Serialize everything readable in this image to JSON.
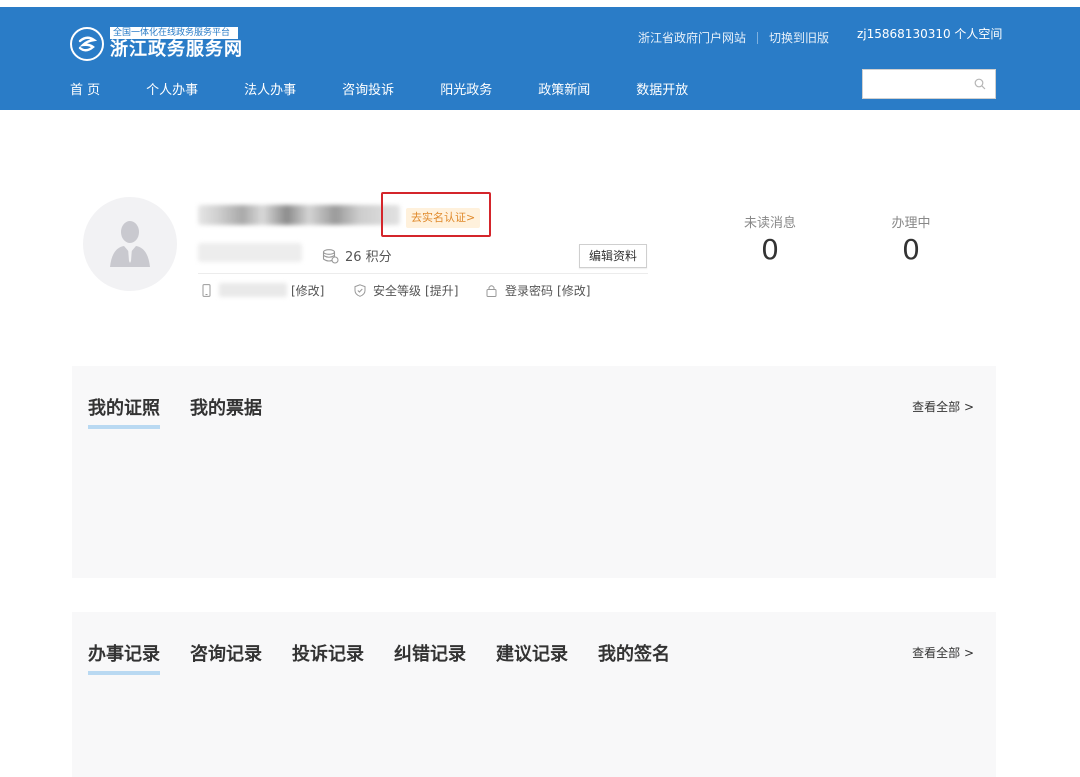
{
  "header": {
    "logo_subtitle": "全国一体化在线政务服务平台",
    "logo_title": "浙江政务服务网",
    "links": [
      "浙江省政府门户网站",
      "切换到旧版"
    ],
    "user_space": "zj15868130310 个人空间",
    "nav": [
      "首 页",
      "个人办事",
      "法人办事",
      "咨询投诉",
      "阳光政务",
      "政策新闻",
      "数据开放"
    ],
    "search_placeholder": ""
  },
  "profile": {
    "realname_link": "去实名认证>",
    "points": "26 积分",
    "edit_button": "编辑资料",
    "phone_action": "[修改]",
    "security_label": "安全等级",
    "security_action": "[提升]",
    "password_label": "登录密码",
    "password_action": "[修改]",
    "stats": [
      {
        "label": "未读消息",
        "value": "0"
      },
      {
        "label": "办理中",
        "value": "0"
      }
    ]
  },
  "panel1": {
    "tabs": [
      "我的证照",
      "我的票据"
    ],
    "active_tab": 0,
    "view_all": "查看全部 >"
  },
  "panel2": {
    "tabs": [
      "办事记录",
      "咨询记录",
      "投诉记录",
      "纠错记录",
      "建议记录",
      "我的签名"
    ],
    "active_tab": 0,
    "view_all": "查看全部 >"
  },
  "colors": {
    "header_bg": "#2a7cc7",
    "realname_text": "#e08a2c",
    "highlight": "#d4252b",
    "tab_underline": "#b9d9f2"
  }
}
